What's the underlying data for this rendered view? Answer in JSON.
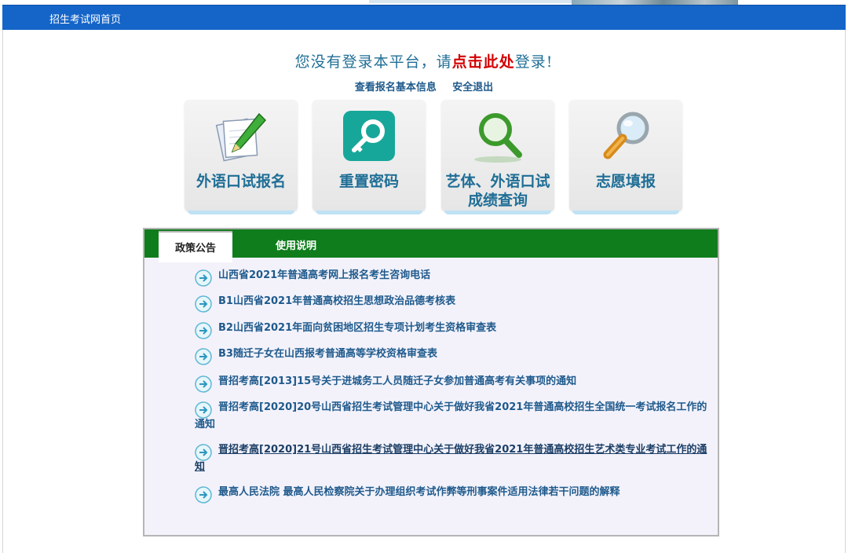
{
  "nav": {
    "home_link": "招生考试网首页"
  },
  "login": {
    "prefix": "您没有登录本平台，请",
    "click": "点击此处",
    "suffix": "登录!"
  },
  "sub_links": {
    "view_info": "查看报名基本信息",
    "logout": "安全退出"
  },
  "tiles": [
    {
      "label": "外语口试报名",
      "icon": "notepad-pen-icon"
    },
    {
      "label": "重置密码",
      "icon": "key-icon"
    },
    {
      "label_line1": "艺体、外语口试",
      "label_line2": "成绩查询",
      "icon": "magnifier-icon"
    },
    {
      "label": "志愿填报",
      "icon": "magnifying-glass-icon"
    }
  ],
  "tabs": {
    "active": "政策公告",
    "inactive": "使用说明"
  },
  "news": [
    "山西省2021年普通高考网上报名考生咨询电话",
    "B1山西省2021年普通高校招生思想政治品德考核表",
    "B2山西省2021年面向贫困地区招生专项计划考生资格审查表",
    "B3随迁子女在山西报考普通高等学校资格审查表",
    "晋招考高[2013]15号关于进城务工人员随迁子女参加普通高考有关事项的通知",
    "晋招考高[2020]20号山西省招生考试管理中心关于做好我省2021年普通高校招生全国统一考试报名工作的通知",
    "晋招考高[2020]21号山西省招生考试管理中心关于做好我省2021年普通高校招生艺术类专业考试工作的通知",
    "最高人民法院 最高人民检察院关于办理组织考试作弊等刑事案件适用法律若干问题的解释"
  ],
  "colors": {
    "nav": "#1565c8",
    "tab_bar": "#0f7d1c",
    "link": "#1f5a8c",
    "accent_red": "#d40000"
  }
}
